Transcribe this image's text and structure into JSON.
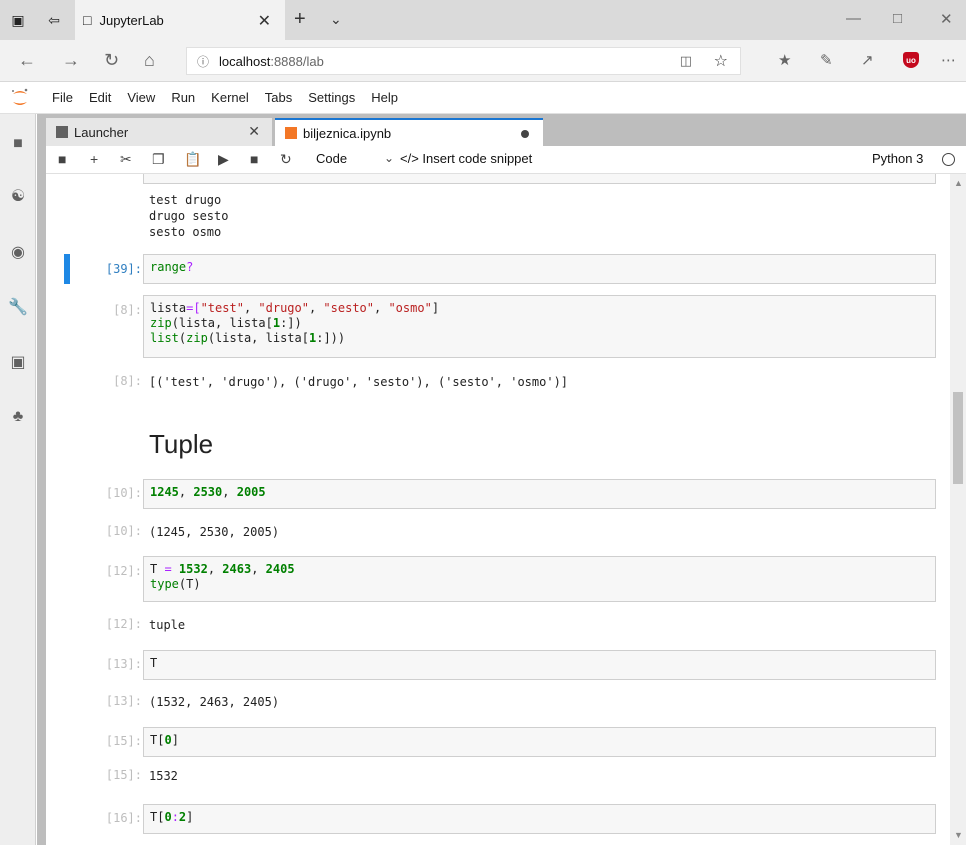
{
  "browser": {
    "tab_title": "JupyterLab",
    "url_host": "localhost",
    "url_path": ":8888/lab"
  },
  "menu": [
    "File",
    "Edit",
    "View",
    "Run",
    "Kernel",
    "Tabs",
    "Settings",
    "Help"
  ],
  "dock_tabs": {
    "launcher": "Launcher",
    "notebook": "biljeznica.ipynb"
  },
  "toolbar": {
    "cell_type": "Code",
    "snippet": "</> Insert code snippet",
    "kernel": "Python 3"
  },
  "cells": {
    "c0_out": "test drugo\ndrugo sesto\nsesto osmo",
    "c1_prompt": "[39]:",
    "c2_prompt": "[8]:",
    "c2_out_prompt": "[8]:",
    "c2_out": "[('test', 'drugo'), ('drugo', 'sesto'), ('sesto', 'osmo')]",
    "heading": "Tuple",
    "c3_prompt": "[10]:",
    "c3_out_prompt": "[10]:",
    "c3_out": "(1245, 2530, 2005)",
    "c4_prompt": "[12]:",
    "c4_out_prompt": "[12]:",
    "c4_out": "tuple",
    "c5_prompt": "[13]:",
    "c5_out_prompt": "[13]:",
    "c5_out": "(1532, 2463, 2405)",
    "c6_prompt": "[15]:",
    "c6_out_prompt": "[15]:",
    "c6_out": "1532",
    "c7_prompt": "[16]:"
  },
  "code": {
    "c1": {
      "a": "range",
      "b": "?"
    },
    "c2": {
      "l1": {
        "a": "lista",
        "b": "=[",
        "c": "\"test\"",
        "d": ", ",
        "e": "\"drugo\"",
        "f": ", ",
        "g": "\"sesto\"",
        "h": ", ",
        "i": "\"osmo\"",
        "j": "]"
      },
      "l2": {
        "a": "zip",
        "b": "(lista, lista[",
        "c": "1",
        "d": ":])"
      },
      "l3": {
        "a": "list",
        "b": "(",
        "c": "zip",
        "d": "(lista, lista[",
        "e": "1",
        "f": ":]))"
      }
    },
    "c3": {
      "a": "1245",
      "b": ", ",
      "c": "2530",
      "d": ", ",
      "e": "2005"
    },
    "c4": {
      "l1": {
        "a": "T ",
        "b": "=",
        "c": " ",
        "d": "1532",
        "e": ", ",
        "f": "2463",
        "g": ", ",
        "h": "2405"
      },
      "l2": {
        "a": "type",
        "b": "(T)"
      }
    },
    "c5": {
      "a": "T"
    },
    "c6": {
      "a": "T[",
      "b": "0",
      "c": "]"
    },
    "c7": {
      "a": "T[",
      "b": "0",
      "c": ":",
      "d": "2",
      "e": "]"
    }
  },
  "colors": {
    "accent": "#1e88e5",
    "keyword": "#008000",
    "string": "#ba2121",
    "operator": "#aa22ff"
  }
}
